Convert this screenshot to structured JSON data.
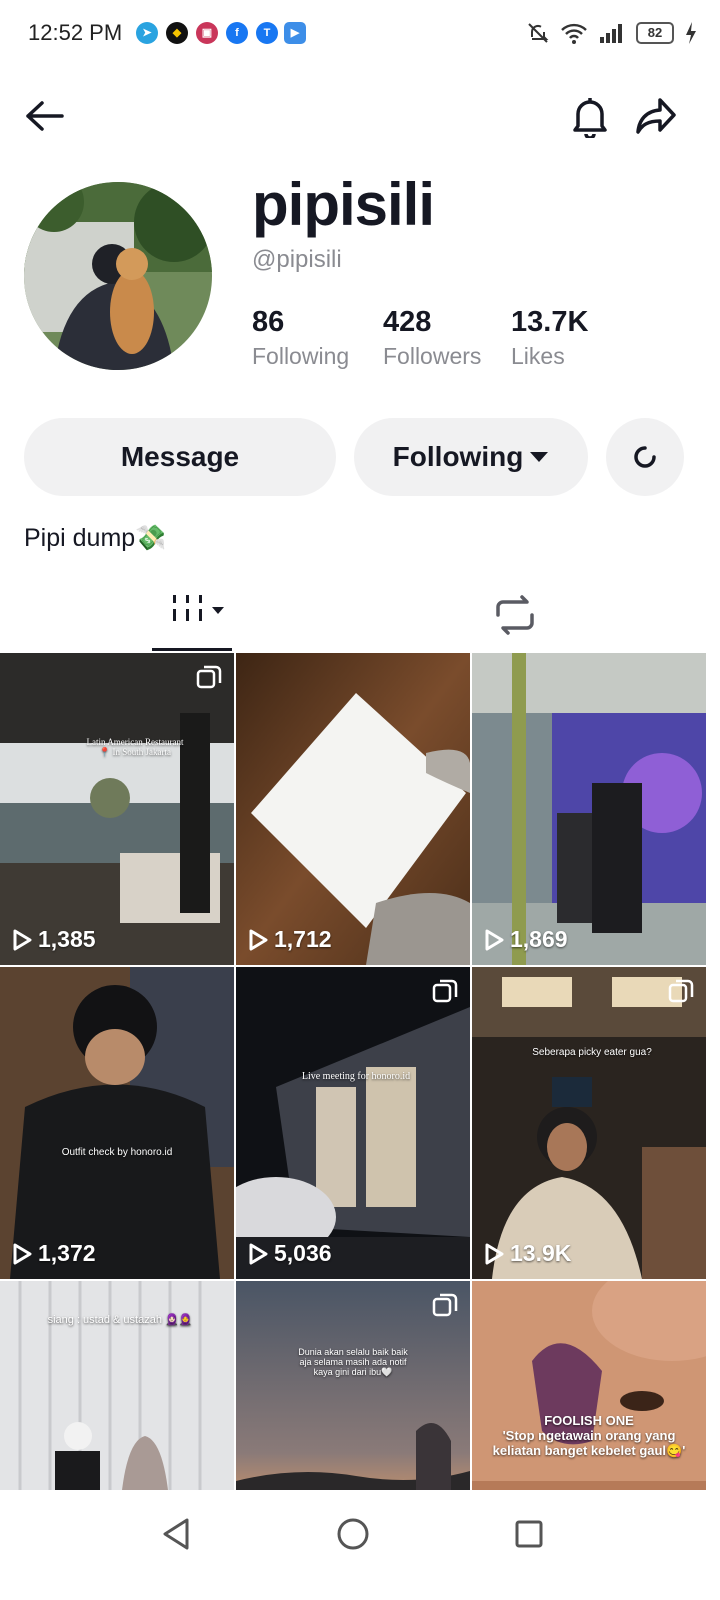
{
  "status_bar": {
    "time": "12:52 PM",
    "battery": "82",
    "notification_icons": [
      "telegram-icon",
      "app-icon",
      "gallery-icon",
      "facebook-icon",
      "tiktok-lite-icon",
      "video-icon"
    ]
  },
  "profile": {
    "display_name": "pipisili",
    "handle": "@pipisili",
    "stats": [
      {
        "value": "86",
        "label": "Following"
      },
      {
        "value": "428",
        "label": "Followers"
      },
      {
        "value": "13.7K",
        "label": "Likes"
      }
    ],
    "bio": "Pipi dump💸"
  },
  "actions": {
    "message_label": "Message",
    "following_label": "Following"
  },
  "videos": [
    {
      "views": "1,385",
      "caption": "Latin American Restaurant\n📍 In South Jakarta",
      "multi": true
    },
    {
      "views": "1,712",
      "caption": "",
      "multi": false
    },
    {
      "views": "1,869",
      "caption": "",
      "multi": false
    },
    {
      "views": "1,372",
      "caption": "Outfit check by honoro.id",
      "multi": false
    },
    {
      "views": "5,036",
      "caption": "Live meeting for honoro.id",
      "multi": true
    },
    {
      "views": "13.9K",
      "caption": "Seberapa picky eater gua?",
      "multi": true
    },
    {
      "views": "",
      "caption": "siang : ustad & ustazah 🧕🏻🧕",
      "multi": false
    },
    {
      "views": "",
      "caption": "Dunia akan selalu baik baik aja selama masih ada notif kaya gini dari ibu🤍",
      "multi": true
    },
    {
      "views": "",
      "caption": "FOOLISH ONE\n'Stop ngetawain orang yang keliatan banget kebelet gaul😋'",
      "multi": false
    }
  ],
  "colors": {
    "text_primary": "#161823",
    "text_secondary": "#8a8b91",
    "pill_bg": "#f1f1f2"
  }
}
